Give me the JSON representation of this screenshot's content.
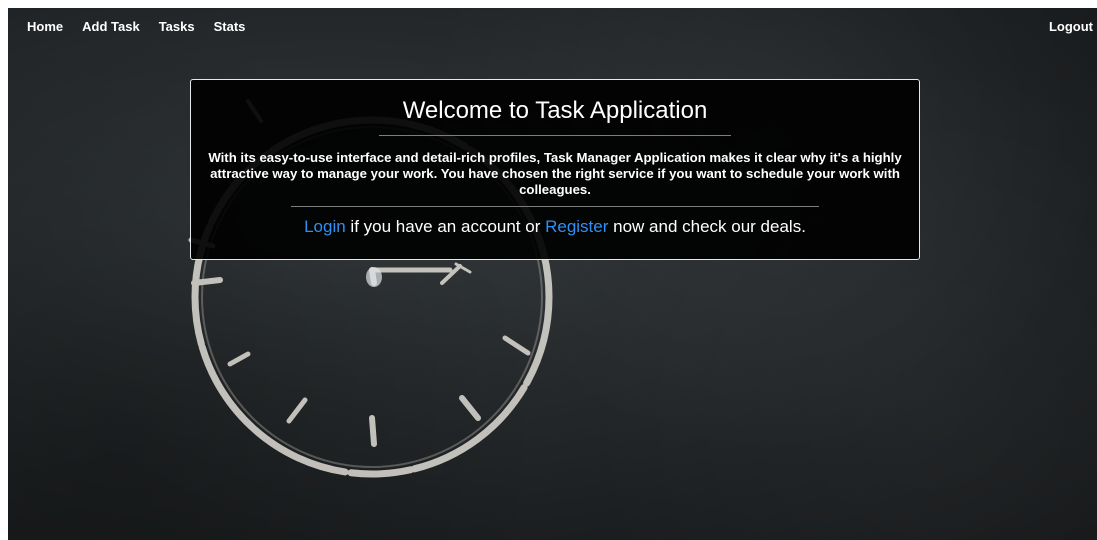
{
  "navbar": {
    "links": [
      "Home",
      "Add Task",
      "Tasks",
      "Stats"
    ],
    "logout_label": "Logout"
  },
  "welcome": {
    "title": "Welcome to Task Application",
    "description": "With its easy-to-use interface and detail-rich profiles, Task Manager Application makes it clear why it's a highly attractive way to manage your work. You have chosen the right service if you want to schedule your work with colleagues.",
    "cta": {
      "login_label": "Login",
      "text_middle": " if you have an account or ",
      "register_label": "Register",
      "text_end": " now and check our deals."
    }
  },
  "background": {
    "icon": "chalk-clock-icon"
  },
  "colors": {
    "link": "#2f8ff5",
    "panel_bg": "#000000",
    "text": "#ffffff"
  }
}
